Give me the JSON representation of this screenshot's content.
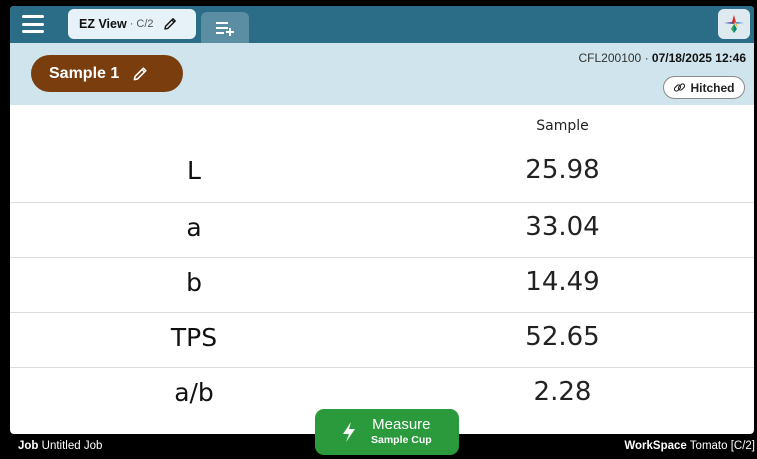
{
  "topbar": {
    "menu_icon": "hamburger-menu-icon",
    "active_tab": {
      "name": "EZ View",
      "separator": "·",
      "sub": "C/2",
      "edit_icon": "pencil-icon"
    },
    "add_tab_icon": "add-list-icon",
    "logo_icon": "app-logo-icon"
  },
  "sample": {
    "name": "Sample 1",
    "edit_icon": "pencil-icon",
    "device": "CFL200100 · ",
    "datetime": "07/18/2025 12:46",
    "hitched_label": "Hitched",
    "hitched_icon": "link-icon"
  },
  "table": {
    "column_header": "Sample",
    "rows": [
      {
        "label": "L",
        "value": "25.98"
      },
      {
        "label": "a",
        "value": "33.04"
      },
      {
        "label": "b",
        "value": "14.49"
      },
      {
        "label": "TPS",
        "value": "52.65"
      },
      {
        "label": "a/b",
        "value": "2.28"
      }
    ]
  },
  "status": {
    "job_label": "Job",
    "job_value": "Untitled Job",
    "workspace_label": "WorkSpace",
    "workspace_value": "Tomato [C/2]"
  },
  "measure": {
    "title": "Measure",
    "subtitle": "Sample Cup",
    "icon": "lightning-bolt-icon"
  },
  "colors": {
    "topbar": "#2b6d86",
    "header": "#cfe4ec",
    "sample_button": "#7a3e0e",
    "measure_button": "#2b9a3c"
  }
}
